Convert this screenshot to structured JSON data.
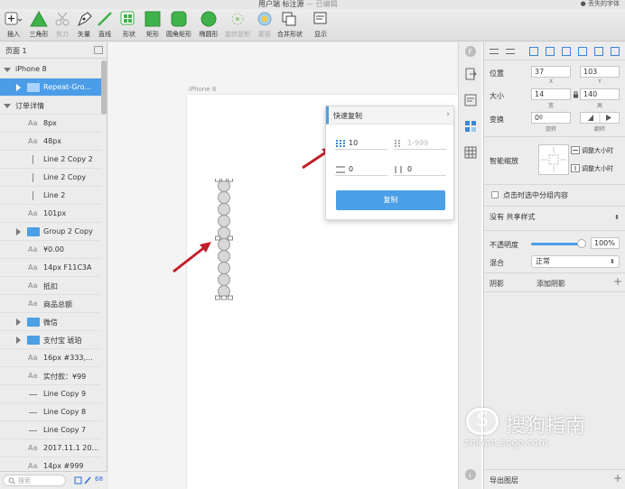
{
  "window": {
    "title": "用户端 标注源",
    "subtitle": "— 已编辑",
    "right_text": "丢失的字体"
  },
  "toolbar": {
    "tools": [
      {
        "id": "insert",
        "label": "插入"
      },
      {
        "id": "triangle",
        "label": "三角形"
      },
      {
        "id": "scissors",
        "label": "剪刀"
      },
      {
        "id": "vector",
        "label": "矢量"
      },
      {
        "id": "line",
        "label": "直线"
      },
      {
        "id": "shape",
        "label": "形状"
      },
      {
        "id": "rect",
        "label": "矩形"
      },
      {
        "id": "rounded-rect",
        "label": "圆角矩形"
      },
      {
        "id": "ellipse",
        "label": "椭圆形"
      },
      {
        "id": "rotate-copy",
        "label": "旋转复制"
      },
      {
        "id": "mask",
        "label": "蒙板"
      },
      {
        "id": "combine",
        "label": "合并形状"
      },
      {
        "id": "display",
        "label": "显示"
      }
    ]
  },
  "layers": {
    "pages_label": "页面 1",
    "items": [
      {
        "label": "iPhone 8",
        "kind": "artboard"
      },
      {
        "label": "Repeat-Gro...",
        "kind": "folder",
        "selected": true
      },
      {
        "label": "订单详情",
        "kind": "group-open"
      },
      {
        "label": "8px",
        "kind": "text"
      },
      {
        "label": "48px",
        "kind": "text"
      },
      {
        "label": "Line 2 Copy 2",
        "kind": "line"
      },
      {
        "label": "Line 2 Copy",
        "kind": "line"
      },
      {
        "label": "Line 2",
        "kind": "line"
      },
      {
        "label": "101px",
        "kind": "text"
      },
      {
        "label": "Group 2 Copy",
        "kind": "folder"
      },
      {
        "label": "¥0.00",
        "kind": "text"
      },
      {
        "label": "14px F11C3A",
        "kind": "text"
      },
      {
        "label": "抵扣",
        "kind": "text"
      },
      {
        "label": "商品总额",
        "kind": "text"
      },
      {
        "label": "微信",
        "kind": "folder"
      },
      {
        "label": "支付宝 琥珀",
        "kind": "folder"
      },
      {
        "label": "16px #333,...",
        "kind": "text"
      },
      {
        "label": "实付款：¥99",
        "kind": "text"
      },
      {
        "label": "Line Copy 9",
        "kind": "line"
      },
      {
        "label": "Line Copy 8",
        "kind": "line"
      },
      {
        "label": "Line Copy 7",
        "kind": "line"
      },
      {
        "label": "2017.11.1 20...",
        "kind": "text"
      },
      {
        "label": "14px #999",
        "kind": "text"
      }
    ],
    "search_placeholder": "搜索",
    "count": "68"
  },
  "canvas": {
    "artboard_label": "iPhone 8",
    "repeat_count": 10
  },
  "quick_copy": {
    "title": "快速复制",
    "count_value": "10",
    "count_placeholder": "1-999",
    "spacing_h": "0",
    "spacing_v": "0",
    "button_label": "复制"
  },
  "inspector": {
    "position_label": "位置",
    "x_value": "37",
    "y_value": "103",
    "x_label": "X",
    "y_label": "Y",
    "size_label": "大小",
    "w_value": "14",
    "h_value": "140",
    "w_label": "宽",
    "h_label": "高",
    "transform_label": "变换",
    "rotate_value": "0º",
    "rotate_label": "旋转",
    "flip_label": "翻转",
    "smart_resize_label": "智能缩放",
    "resize_opt1": "调整大小时",
    "resize_opt2": "调整大小时",
    "click_select_label": "点击时选中分组内容",
    "shared_style": "没有 共享样式",
    "opacity_label": "不透明度",
    "opacity_value": "100%",
    "opacity": 1.0,
    "blend_label": "混合",
    "blend_value": "正常",
    "shadow_label": "阴影",
    "shadow_add": "添加阴影",
    "export_label": "导出图层"
  },
  "watermark": {
    "text": "搜狗指南",
    "url": "zhinan.sogo.com"
  }
}
